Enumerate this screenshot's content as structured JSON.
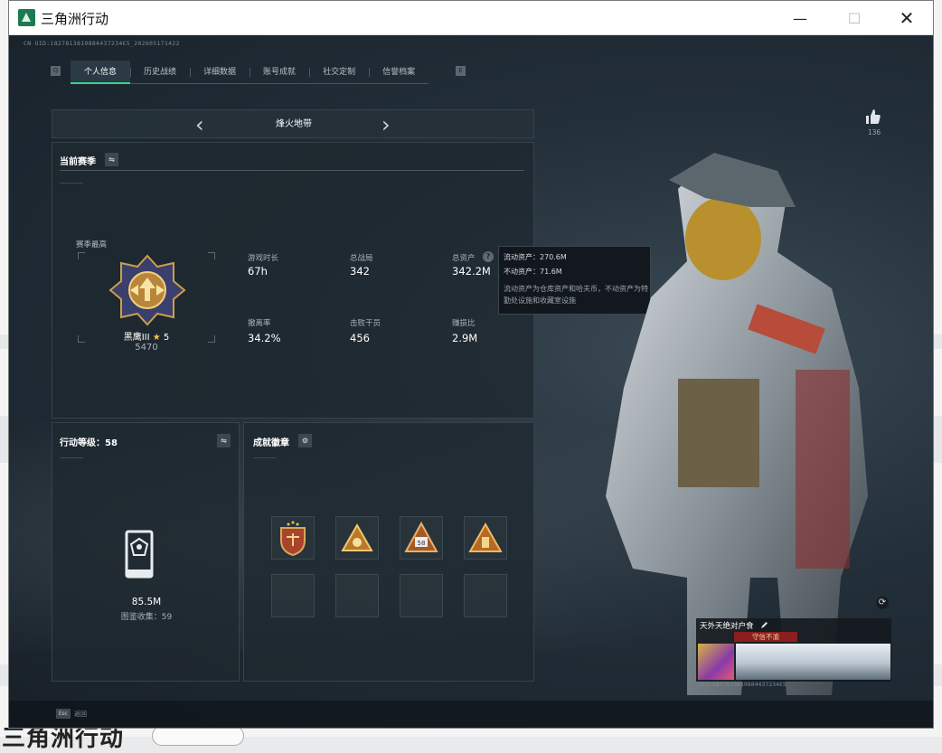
{
  "window": {
    "title": "三角洲行动",
    "controls": {
      "minimize": "—",
      "maximize": "☐",
      "close": "✕"
    }
  },
  "background_page": {
    "title": "三角洲行动"
  },
  "header": {
    "uid": "CN UID:1827813819884437234€5_202605171422"
  },
  "tabs": [
    {
      "label": "个人信息",
      "active": true
    },
    {
      "label": "历史战绩",
      "active": false
    },
    {
      "label": "详细数据",
      "active": false
    },
    {
      "label": "账号成就",
      "active": false
    },
    {
      "label": "社交定制",
      "active": false
    },
    {
      "label": "信誉档案",
      "active": false
    }
  ],
  "mode_selector": {
    "prev": "‹",
    "mode": "烽火地带",
    "next": "›"
  },
  "season": {
    "title": "当前赛季",
    "swap_icon": "⇋",
    "top_label": "赛季最高",
    "rank_name": "黑鹰III",
    "rank_star": "★",
    "rank_stars": "5",
    "rank_score": "5470",
    "stats": [
      {
        "label": "游戏时长",
        "value": "67h"
      },
      {
        "label": "总战局",
        "value": "342"
      },
      {
        "label": "总资产",
        "value": "342.2M"
      },
      {
        "label": "撤离率",
        "value": "34.2%"
      },
      {
        "label": "击败干员",
        "value": "456"
      },
      {
        "label": "赚损比",
        "value": "2.9M"
      }
    ],
    "help_icon": "?"
  },
  "tooltip": {
    "liquid": "流动资产：270.6M",
    "fixed": "不动资产：71.6M",
    "desc": "流动资产为仓库资产和哈夫币，不动资产为特勤处设施和收藏室设施"
  },
  "level": {
    "title": "行动等级：58",
    "swap_icon": "⇋",
    "value": "85.5M",
    "collect": "图鉴收集：59"
  },
  "badges": {
    "title": "成就徽章",
    "settings_icon": "⚙",
    "badge_58_label": "58"
  },
  "profile": {
    "like_count": "136",
    "refresh_icon": "⟳",
    "card_name": "天外天绝对户食",
    "card_tag": "守信不渝",
    "card_uid": "UID:1827813819884437234€5"
  },
  "footer": {
    "esc_key": "Esc",
    "esc_label": "返回"
  },
  "colors": {
    "accent": "#3bd08a",
    "panel": "#1e2830",
    "tag_red": "#8c1e1e",
    "gold": "#f0c64a"
  }
}
